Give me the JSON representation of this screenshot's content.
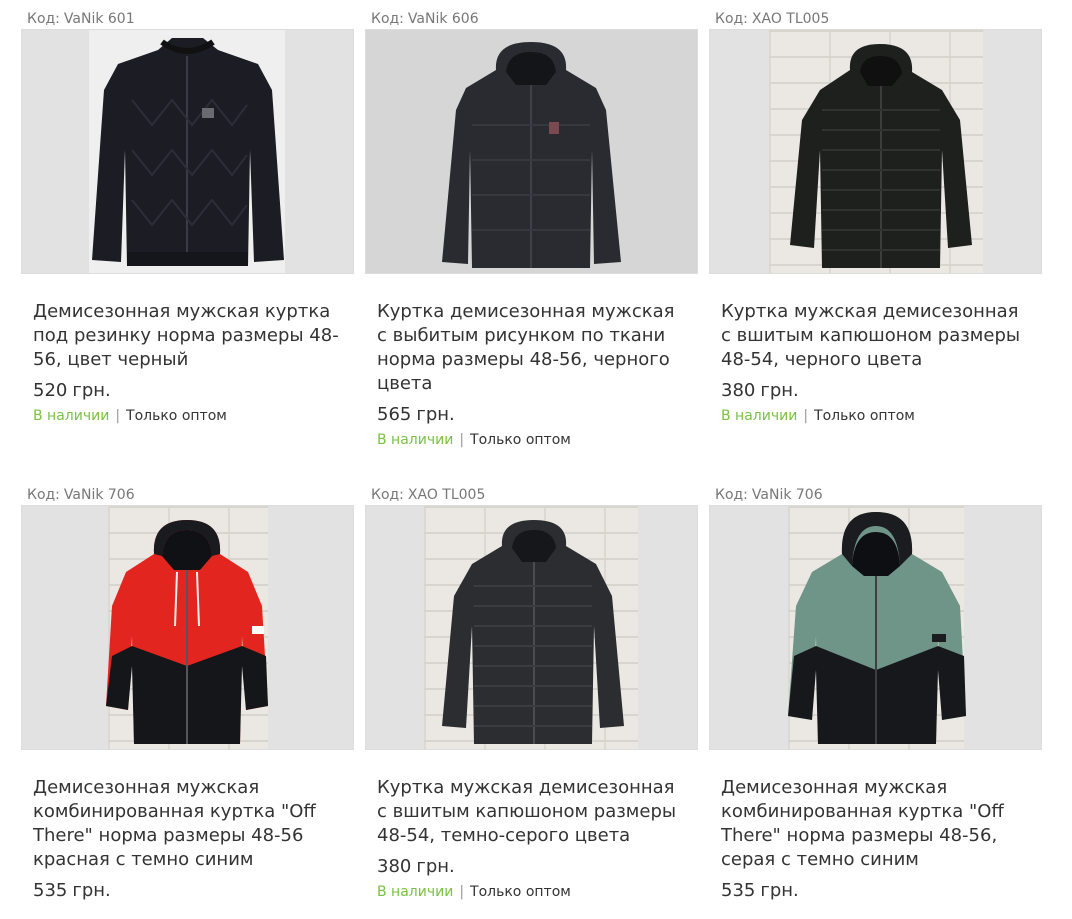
{
  "code_label": "Код:",
  "currency": "грн.",
  "status_in_stock": "В наличии",
  "separator": "|",
  "wholesale_only": "Только оптом",
  "colors": {
    "stock_green": "#7ac142",
    "text": "#333333",
    "muted": "#777777"
  },
  "products": [
    {
      "code": "VaNik 601",
      "title": "Демисезонная мужская куртка под резинку норма размеры 48-56, цвет черный",
      "price": "520",
      "image": "black-bomber-jacket"
    },
    {
      "code": "VaNik 606",
      "title": "Куртка демисезонная мужская с выбитым рисунком по ткани норма размеры 48-56, черного цвета",
      "price": "565",
      "image": "dark-grey-hooded-jacket"
    },
    {
      "code": "XAO TL005",
      "title": "Куртка мужская демисезонная с вшитым капюшоном размеры 48-54, черного цвета",
      "price": "380",
      "image": "black-quilted-hooded-jacket"
    },
    {
      "code": "VaNik 706",
      "title": "Демисезонная мужская комбинированная куртка \"Off There\" норма размеры 48-56 красная с темно синим",
      "price": "535",
      "image": "red-black-windbreaker"
    },
    {
      "code": "XAO TL005",
      "title": "Куртка мужская демисезонная с вшитым капюшоном размеры 48-54, темно-серого цвета",
      "price": "380",
      "image": "dark-grey-quilted-jacket"
    },
    {
      "code": "VaNik 706",
      "title": "Демисезонная мужская комбинированная куртка \"Off There\" норма размеры 48-56, серая с темно синим",
      "price": "535",
      "image": "grey-green-black-windbreaker"
    }
  ]
}
